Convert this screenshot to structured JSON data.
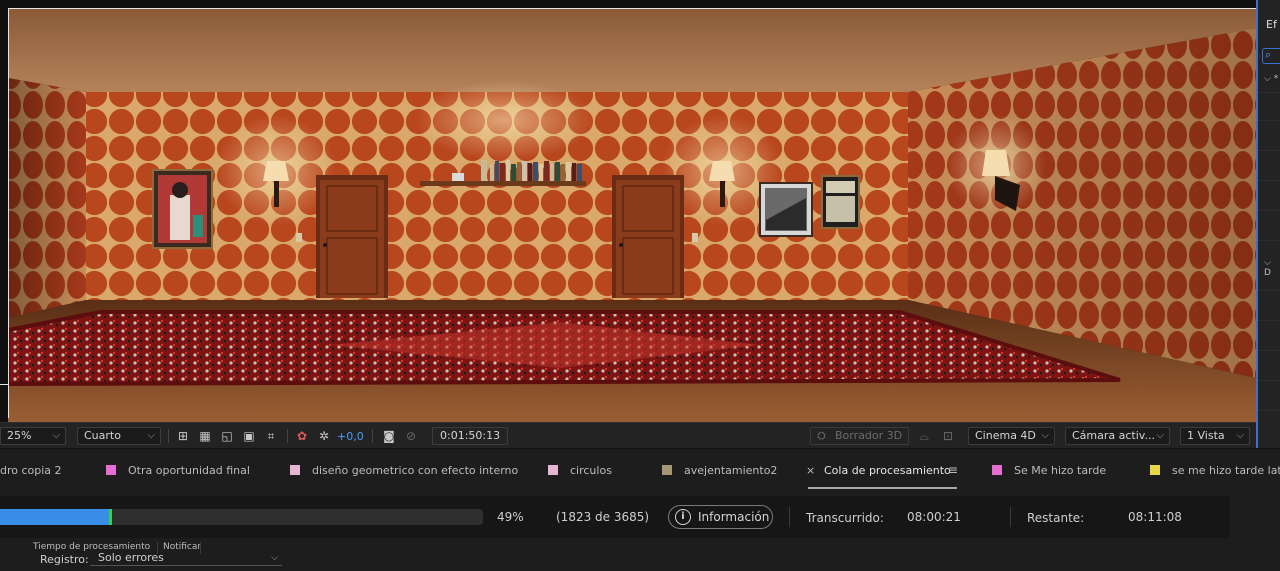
{
  "viewer": {
    "zoom": "25%",
    "resolution": "Cuarto",
    "exposure": "+0,0",
    "timecode": "0:01:50:13",
    "borrador_label": "Borrador 3D",
    "renderer": "Cinema 4D",
    "camera": "Cámara activ...",
    "views": "1 Vista"
  },
  "right_panel": {
    "tab_label": "Ef",
    "twirl_1": "* ",
    "twirl_2": "D"
  },
  "tabs": [
    {
      "label": "dro copia 2",
      "color": "#e6a6c6"
    },
    {
      "label": "Otra oportunidad final",
      "color": "#e66ed3"
    },
    {
      "label": "diseño geometrico con efecto interno",
      "color": "#e6b6d0"
    },
    {
      "label": "circulos",
      "color": "#e6b6d0"
    },
    {
      "label": "avejentamiento2",
      "color": "#a79776"
    },
    {
      "label": "Cola de procesamiento",
      "color": ""
    },
    {
      "label": "Se Me hizo tarde",
      "color": "#e66ed3"
    },
    {
      "label": "se me hizo tarde later",
      "color": "#e6d84a"
    }
  ],
  "tab_controls": {
    "close_glyph": "×",
    "menu_glyph": "≡"
  },
  "render_queue": {
    "progress_percent": 49,
    "percent_text": "49%",
    "frames_text": "(1823 de 3685)",
    "info_label": "Información",
    "info_glyph": "i",
    "elapsed_label": "Transcurrido:",
    "elapsed_value": "08:00:21",
    "remaining_label": "Restante:",
    "remaining_value": "08:11:08"
  },
  "bottom": {
    "col_processing_time": "Tiempo de procesamiento",
    "col_notify": "Notificar",
    "registro_label": "Registro:",
    "registro_value": "Solo errores"
  }
}
